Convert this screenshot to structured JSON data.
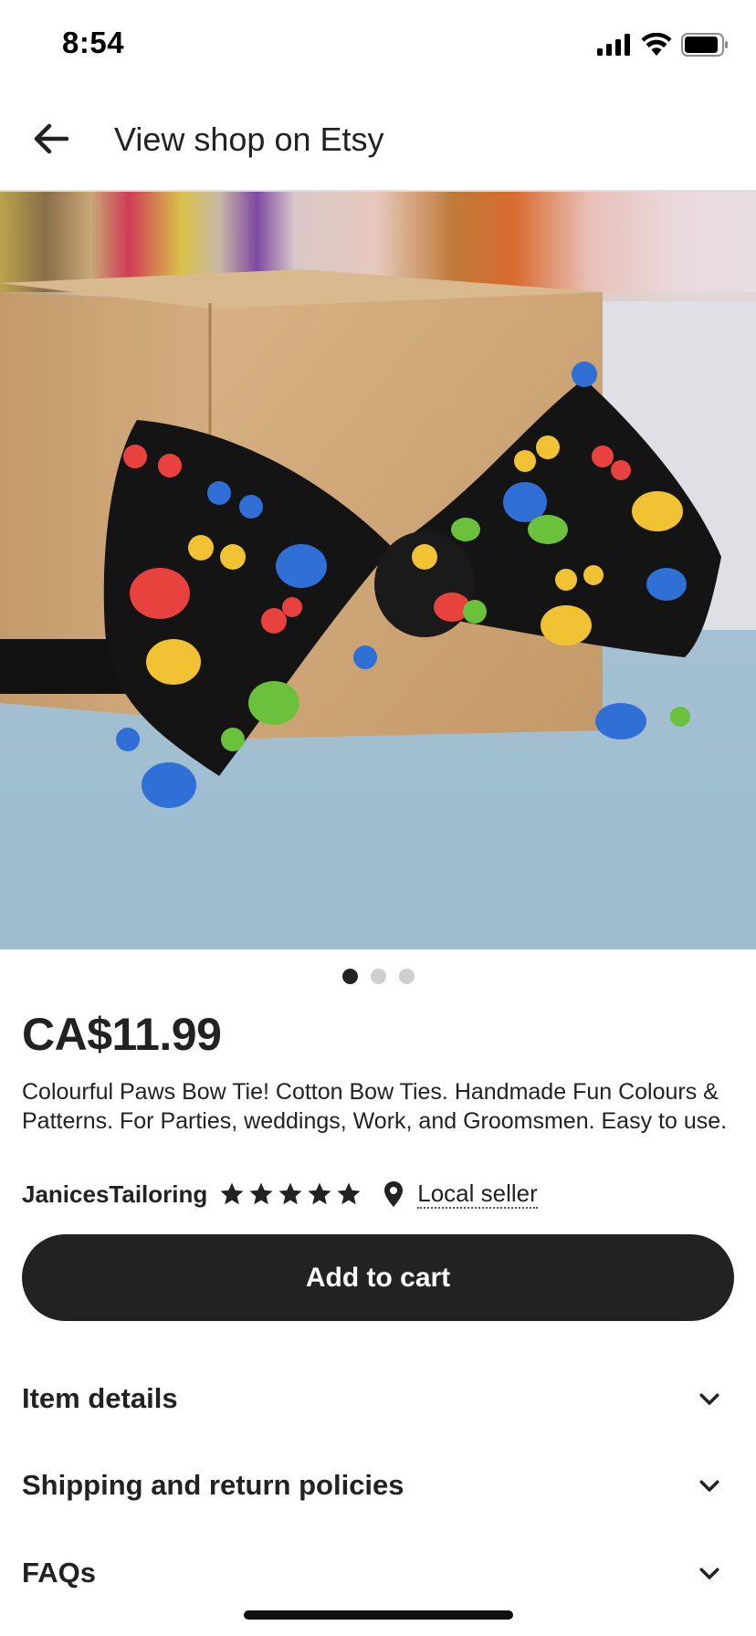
{
  "status_bar": {
    "time": "8:54"
  },
  "nav": {
    "title": "View shop on Etsy"
  },
  "gallery": {
    "image_count": 3,
    "active_index": 0,
    "image_alt": "product-photo"
  },
  "product": {
    "price": "CA$11.99",
    "title": "Colourful Paws Bow Tie! Cotton Bow Ties. Handmade Fun Colours & Patterns. For Parties, weddings, Work, and Groomsmen. Easy to use.",
    "seller": "JanicesTailoring",
    "rating_stars": 5,
    "local_seller_label": "Local seller"
  },
  "actions": {
    "add_to_cart": "Add to cart"
  },
  "sections": [
    {
      "label": "Item details"
    },
    {
      "label": "Shipping and return policies"
    },
    {
      "label": "FAQs"
    }
  ],
  "colors": {
    "primary_text": "#222222",
    "button_bg": "#222222",
    "button_text": "#ffffff",
    "dot_inactive": "#cfcfcf"
  }
}
